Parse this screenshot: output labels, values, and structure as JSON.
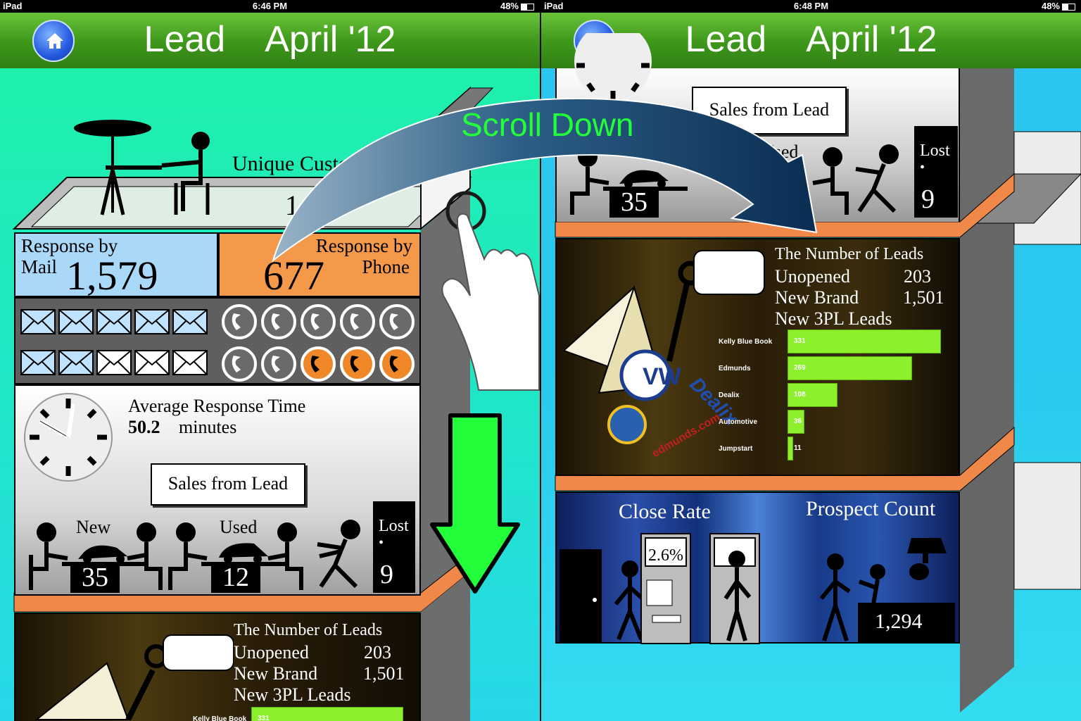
{
  "left": {
    "status": {
      "device": "iPad",
      "time": "6:46 PM",
      "battery": "48%"
    },
    "title_word": "Lead",
    "title_month": "April '12",
    "unique_customers_label": "Unique Customers",
    "unique_customers_value": "1,305",
    "response_mail_label": "Response by",
    "response_mail_label2": "Mail",
    "response_mail_value": "1,579",
    "response_phone_label": "Response by",
    "response_phone_label2": "Phone",
    "response_phone_value": "677",
    "avg_response_label": "Average Response Time",
    "avg_response_value": "50.2",
    "avg_response_unit": "minutes",
    "sales_from_lead_label": "Sales from Lead",
    "new_label": "New",
    "new_value": "35",
    "used_label": "Used",
    "used_value": "12",
    "lost_label": "Lost",
    "lost_value": "9",
    "leads_title": "The Number of Leads",
    "unopened_label": "Unopened",
    "unopened_value": "203",
    "new_brand_label": "New Brand",
    "new_brand_value": "1,501",
    "new_3pl_label": "New 3PL Leads",
    "bar_peek_label": "Kelly Blue Book",
    "bar_peek_value": "331"
  },
  "right": {
    "status": {
      "device": "iPad",
      "time": "6:48 PM",
      "battery": "48%"
    },
    "title_word": "Lead",
    "title_month": "April '12",
    "sales_from_lead_label": "Sales from Lead",
    "used_partial": "Used",
    "new_value": "35",
    "lost_label": "Lost",
    "lost_value": "9",
    "leads_title": "The Number of Leads",
    "unopened_label": "Unopened",
    "unopened_value": "203",
    "new_brand_label": "New Brand",
    "new_brand_value": "1,501",
    "new_3pl_label": "New 3PL Leads",
    "logo_vw": "VW",
    "logo_dealix": "Dealix",
    "logo_edmunds": "edmunds.com",
    "close_rate_label": "Close Rate",
    "close_rate_value": "2.6%",
    "prospect_count_label": "Prospect Count",
    "prospect_count_value": "1,294"
  },
  "overlay": {
    "scroll_down_label": "Scroll Down"
  },
  "chart_data": {
    "type": "bar",
    "title": "New 3PL Leads",
    "categories": [
      "Kelly Blue Book",
      "Edmunds",
      "Dealix",
      "Automotive",
      "Jumpstart"
    ],
    "values": [
      331,
      269,
      108,
      36,
      11
    ],
    "orientation": "horizontal",
    "bar_color": "#8cf02c"
  },
  "icons": {
    "mail_response_icons": 10,
    "phone_response_icons": {
      "grey": 7,
      "orange": 3
    }
  }
}
